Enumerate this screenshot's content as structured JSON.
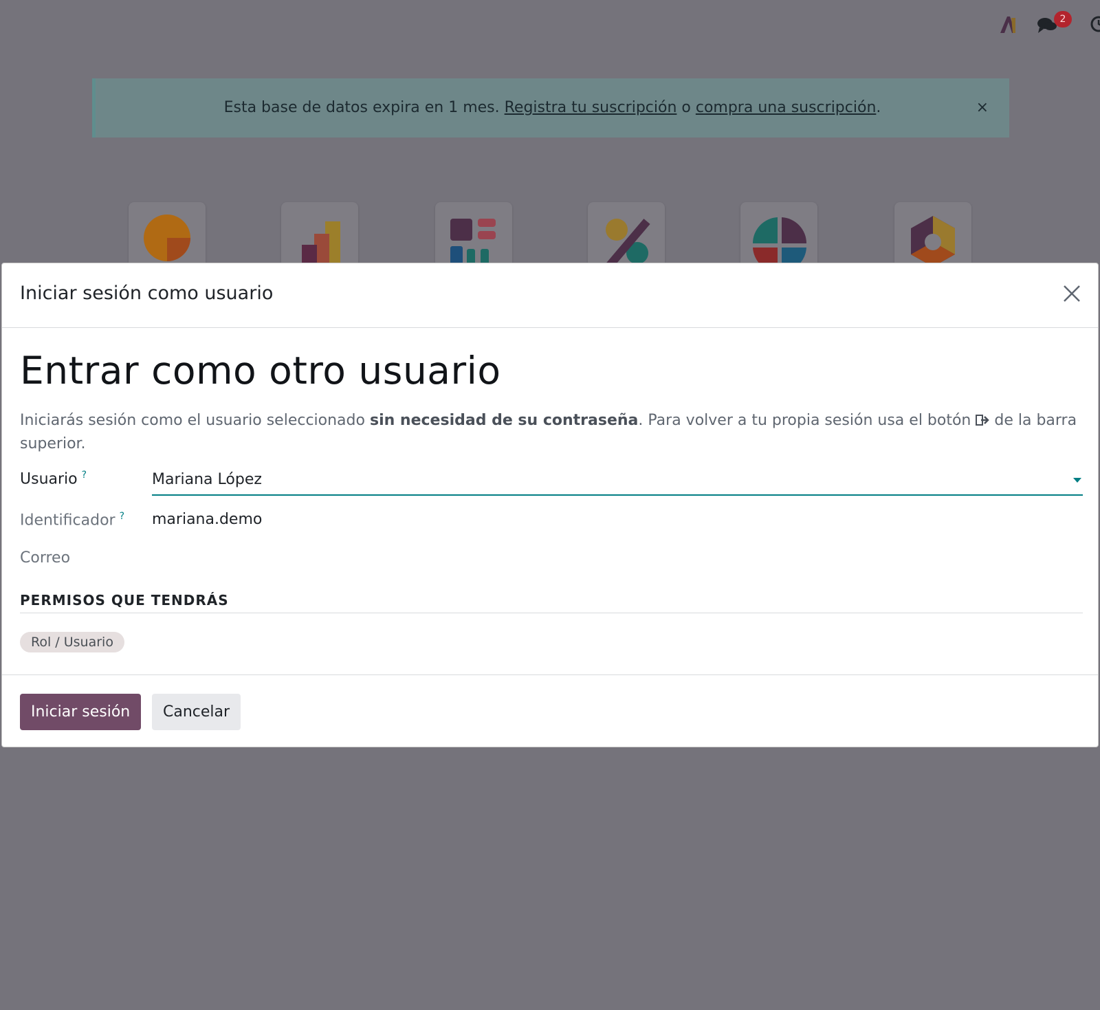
{
  "systray": {
    "notification_count": "2"
  },
  "banner": {
    "text_before": "Esta base de datos expira en 1 mes. ",
    "link_register": "Registra tu suscripción",
    "text_middle": " o ",
    "link_buy": "compra una suscripción",
    "text_after": ".",
    "close_glyph": "×"
  },
  "apps": [
    {
      "icon": "discuss-app-icon"
    },
    {
      "icon": "reporting-app-icon"
    },
    {
      "icon": "dashboards-app-icon"
    },
    {
      "icon": "discounts-app-icon"
    },
    {
      "icon": "planning-app-icon"
    },
    {
      "icon": "settings-app-icon"
    }
  ],
  "modal": {
    "title": "Iniciar sesión como usuario",
    "heading": "Entrar como otro usuario",
    "intro_before": "Iniciarás sesión como el usuario seleccionado ",
    "intro_bold": "sin necesidad de su contraseña",
    "intro_after_1": ". Para volver a tu propia sesión usa el botón ",
    "intro_after_2": " de la barra superior.",
    "fields": {
      "user_label": "Usuario",
      "user_value": "Mariana López",
      "login_label": "Identificador",
      "login_value": "mariana.demo",
      "email_label": "Correo",
      "help_mark": "?"
    },
    "section_title": "PERMISOS QUE TENDRÁS",
    "tags": [
      "Rol / Usuario"
    ],
    "buttons": {
      "primary": "Iniciar sesión",
      "secondary": "Cancelar"
    }
  },
  "colors": {
    "primary": "#714b67",
    "accent": "#017e84",
    "badge": "#b3242d"
  }
}
